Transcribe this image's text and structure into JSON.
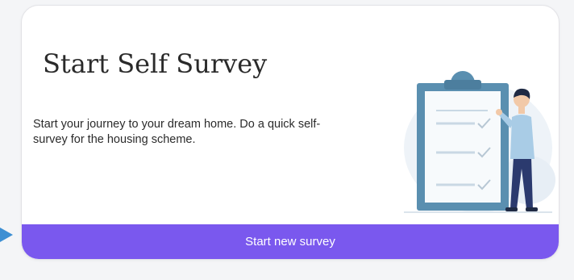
{
  "card": {
    "title": "Start Self Survey",
    "description": "Start your journey to your dream home. Do a quick self-survey for the housing scheme.",
    "illustration_icon": "survey-checklist-illustration",
    "cta_label": "Start new survey"
  },
  "colors": {
    "accent": "#7a58ee",
    "card_background": "#ffffff",
    "page_background": "#f4f5f7",
    "illustration_primary": "#5a8fb0",
    "pointer": "#3d8fd3"
  }
}
